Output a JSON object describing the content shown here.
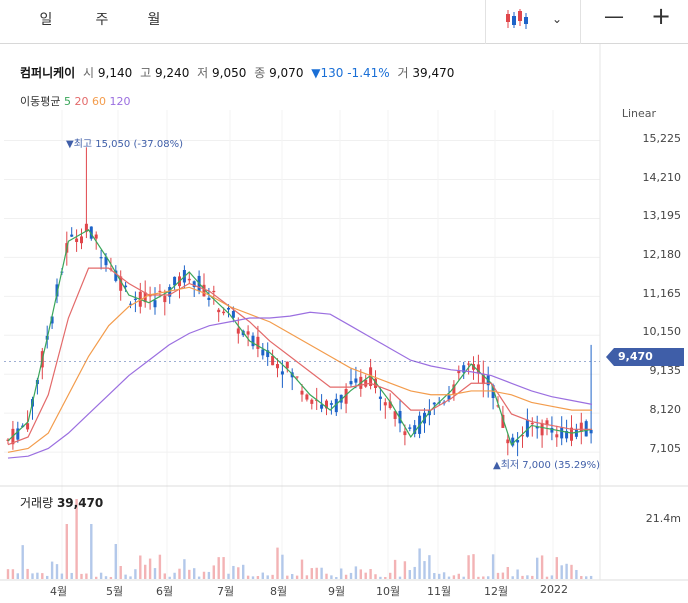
{
  "tabs": [
    {
      "label": "일",
      "active": true
    },
    {
      "label": "주",
      "active": false
    },
    {
      "label": "월",
      "active": false
    }
  ],
  "toolbar": {
    "chart_icon": "candlestick-icon",
    "dropdown_icon": "chevron-down-icon",
    "minus": "—",
    "plus": "+"
  },
  "quote": {
    "name": "컴퍼니케이",
    "open_label": "시",
    "open": "9,140",
    "high_label": "고",
    "high": "9,240",
    "low_label": "저",
    "low": "9,050",
    "close_label": "종",
    "close": "9,070",
    "change": "▼130 -1.41%",
    "volume_label": "거",
    "volume": "39,470"
  },
  "moving_average": {
    "label": "이동평균",
    "periods": [
      "5",
      "20",
      "60",
      "120"
    ],
    "colors": [
      "#3aa65a",
      "#e36a6a",
      "#f39c4c",
      "#9b6fe0"
    ]
  },
  "scale_mode": "Linear",
  "current_price_tag": "9,470",
  "annotations": {
    "high": "▼최고 15,050 (-37.08%)",
    "low": "▲최저 7,000 (35.29%)"
  },
  "volume_panel": {
    "label": "거래량",
    "value": "39,470",
    "axis_label": "21.4m"
  },
  "colors": {
    "up": "#e0464b",
    "down": "#1d63c8",
    "accent": "#3f5ea8"
  },
  "chart_data": {
    "type": "candlestick",
    "y_ticks": [
      "15,225",
      "14,210",
      "13,195",
      "12,180",
      "11,165",
      "10,150",
      "9,135",
      "8,120",
      "7,105"
    ],
    "ylim": [
      6900,
      15500
    ],
    "x_ticks": [
      "4월",
      "5월",
      "6월",
      "7월",
      "8월",
      "9월",
      "10월",
      "11월",
      "12월",
      "2022"
    ],
    "series": [
      {
        "name": "5",
        "values": [
          7400,
          7900,
          10200,
          12600,
          12900,
          12100,
          11200,
          11000,
          11300,
          11800,
          11200,
          10700,
          10000,
          9700,
          9200,
          8600,
          8200,
          8700,
          9100,
          8400,
          7500,
          8200,
          8700,
          9400,
          8900,
          7300,
          7800,
          7700,
          7600,
          7700
        ]
      },
      {
        "name": "20",
        "values": [
          7300,
          7500,
          8600,
          10600,
          11900,
          11900,
          11500,
          11200,
          11200,
          11500,
          11300,
          10900,
          10500,
          10000,
          9600,
          9200,
          8800,
          8800,
          8900,
          8700,
          8200,
          8200,
          8500,
          8900,
          8900,
          8100,
          7900,
          7800,
          7700,
          7700
        ]
      },
      {
        "name": "60",
        "values": [
          7100,
          7200,
          7600,
          8600,
          9600,
          10400,
          10900,
          11200,
          11300,
          11400,
          11200,
          10900,
          10700,
          10500,
          10200,
          9900,
          9600,
          9300,
          9100,
          8900,
          8700,
          8600,
          8600,
          8700,
          8700,
          8600,
          8400,
          8300,
          8200,
          8200
        ]
      },
      {
        "name": "120",
        "values": [
          6950,
          7000,
          7200,
          7600,
          8100,
          8600,
          9100,
          9500,
          9900,
          10200,
          10400,
          10500,
          10600,
          10600,
          10650,
          10750,
          10700,
          10400,
          10100,
          9800,
          9500,
          9350,
          9250,
          9200,
          9100,
          8900,
          8700,
          8550,
          8450,
          8350
        ]
      }
    ]
  }
}
